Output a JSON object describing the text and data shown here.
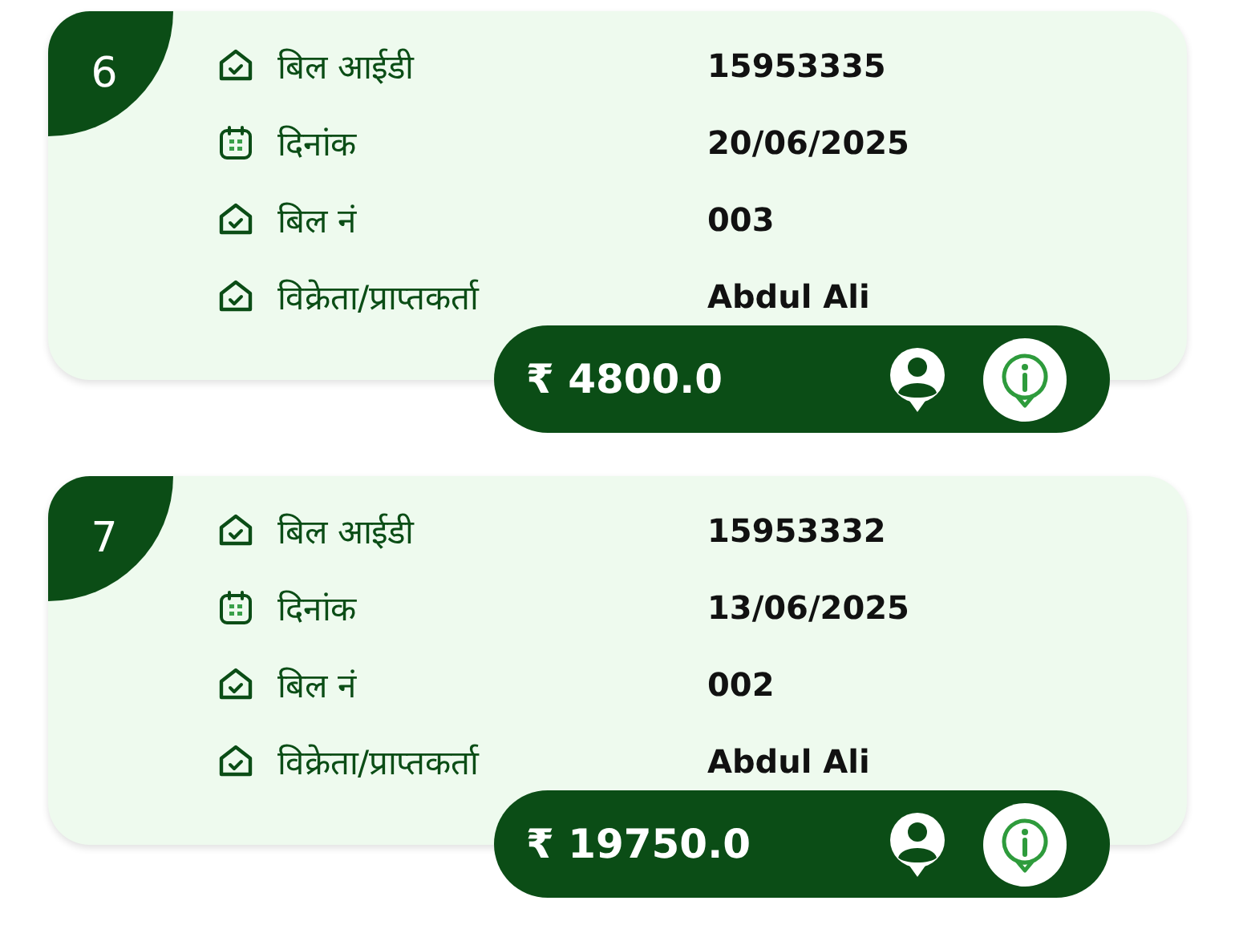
{
  "bills": [
    {
      "number": "6",
      "rows": [
        {
          "kind": "house",
          "label": "बिल आईडी",
          "value": "15953335"
        },
        {
          "kind": "calendar",
          "label": "दिनांक",
          "value": "20/06/2025"
        },
        {
          "kind": "house",
          "label": "बिल नं",
          "value": "003"
        },
        {
          "kind": "house",
          "label": "विक्रेता/प्राप्तकर्ता",
          "value": "Abdul Ali"
        }
      ],
      "amount": "₹ 4800.0"
    },
    {
      "number": "7",
      "rows": [
        {
          "kind": "house",
          "label": "बिल आईडी",
          "value": "15953332"
        },
        {
          "kind": "calendar",
          "label": "दिनांक",
          "value": "13/06/2025"
        },
        {
          "kind": "house",
          "label": "बिल नं",
          "value": "002"
        },
        {
          "kind": "house",
          "label": "विक्रेता/प्राप्तकर्ता",
          "value": "Abdul Ali"
        }
      ],
      "amount": "₹ 19750.0"
    }
  ]
}
